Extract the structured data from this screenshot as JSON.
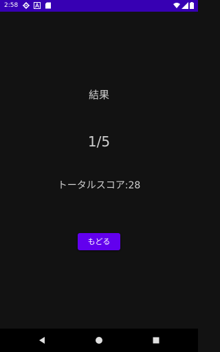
{
  "status_bar": {
    "time": "2:58",
    "background": "#3700b3",
    "left_icons": [
      "settings-icon",
      "notification-a-icon",
      "sd-card-icon"
    ],
    "right_icons": [
      "wifi-icon",
      "signal-icon",
      "battery-icon"
    ]
  },
  "result": {
    "title": "結果",
    "score": "1/5",
    "total_score": "トータルスコア:28"
  },
  "back_button": {
    "label": "もどる",
    "color": "#6200ee"
  },
  "nav_bar": {
    "icons": [
      "back-triangle-icon",
      "home-circle-icon",
      "recents-square-icon"
    ]
  }
}
